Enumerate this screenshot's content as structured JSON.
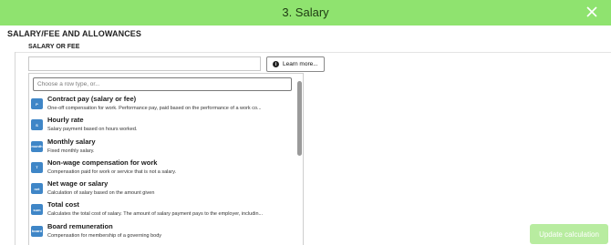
{
  "header": {
    "title": "3. Salary"
  },
  "section": {
    "title": "SALARY/FEE AND ALLOWANCES",
    "subtitle": "SALARY OR FEE"
  },
  "learn_more": {
    "label": "Learn more..."
  },
  "dropdown": {
    "search_placeholder": "Choose a row type, or...",
    "options": [
      {
        "badge": "P",
        "name": "Contract pay (salary or fee)",
        "desc": "One-off compensation for work. Performance pay, paid based on the performance of a work co..."
      },
      {
        "badge": "S",
        "name": "Hourly rate",
        "desc": "Salary payment based on hours worked."
      },
      {
        "badge": "month",
        "name": "Monthly salary",
        "desc": "Fixed monthly salary."
      },
      {
        "badge": "T",
        "name": "Non-wage compensation for work",
        "desc": "Compensation paid for work or service that is not a salary."
      },
      {
        "badge": "net",
        "name": "Net wage or salary",
        "desc": "Calculation of salary based on the amount given"
      },
      {
        "badge": "sum",
        "name": "Total cost",
        "desc": "Calculates the total cost of salary. The amount of salary payment pays to the employer, includin..."
      },
      {
        "badge": "board",
        "name": "Board remuneration",
        "desc": "Compensation for membership of a governing body"
      }
    ]
  },
  "update_button": {
    "label": "Update calculation"
  },
  "colors": {
    "header_bg": "#8fe36f",
    "badge_bg": "#3f86c7",
    "update_bg": "#b8eca0"
  },
  "icons": {
    "close": "close-icon",
    "info": "info-icon"
  }
}
